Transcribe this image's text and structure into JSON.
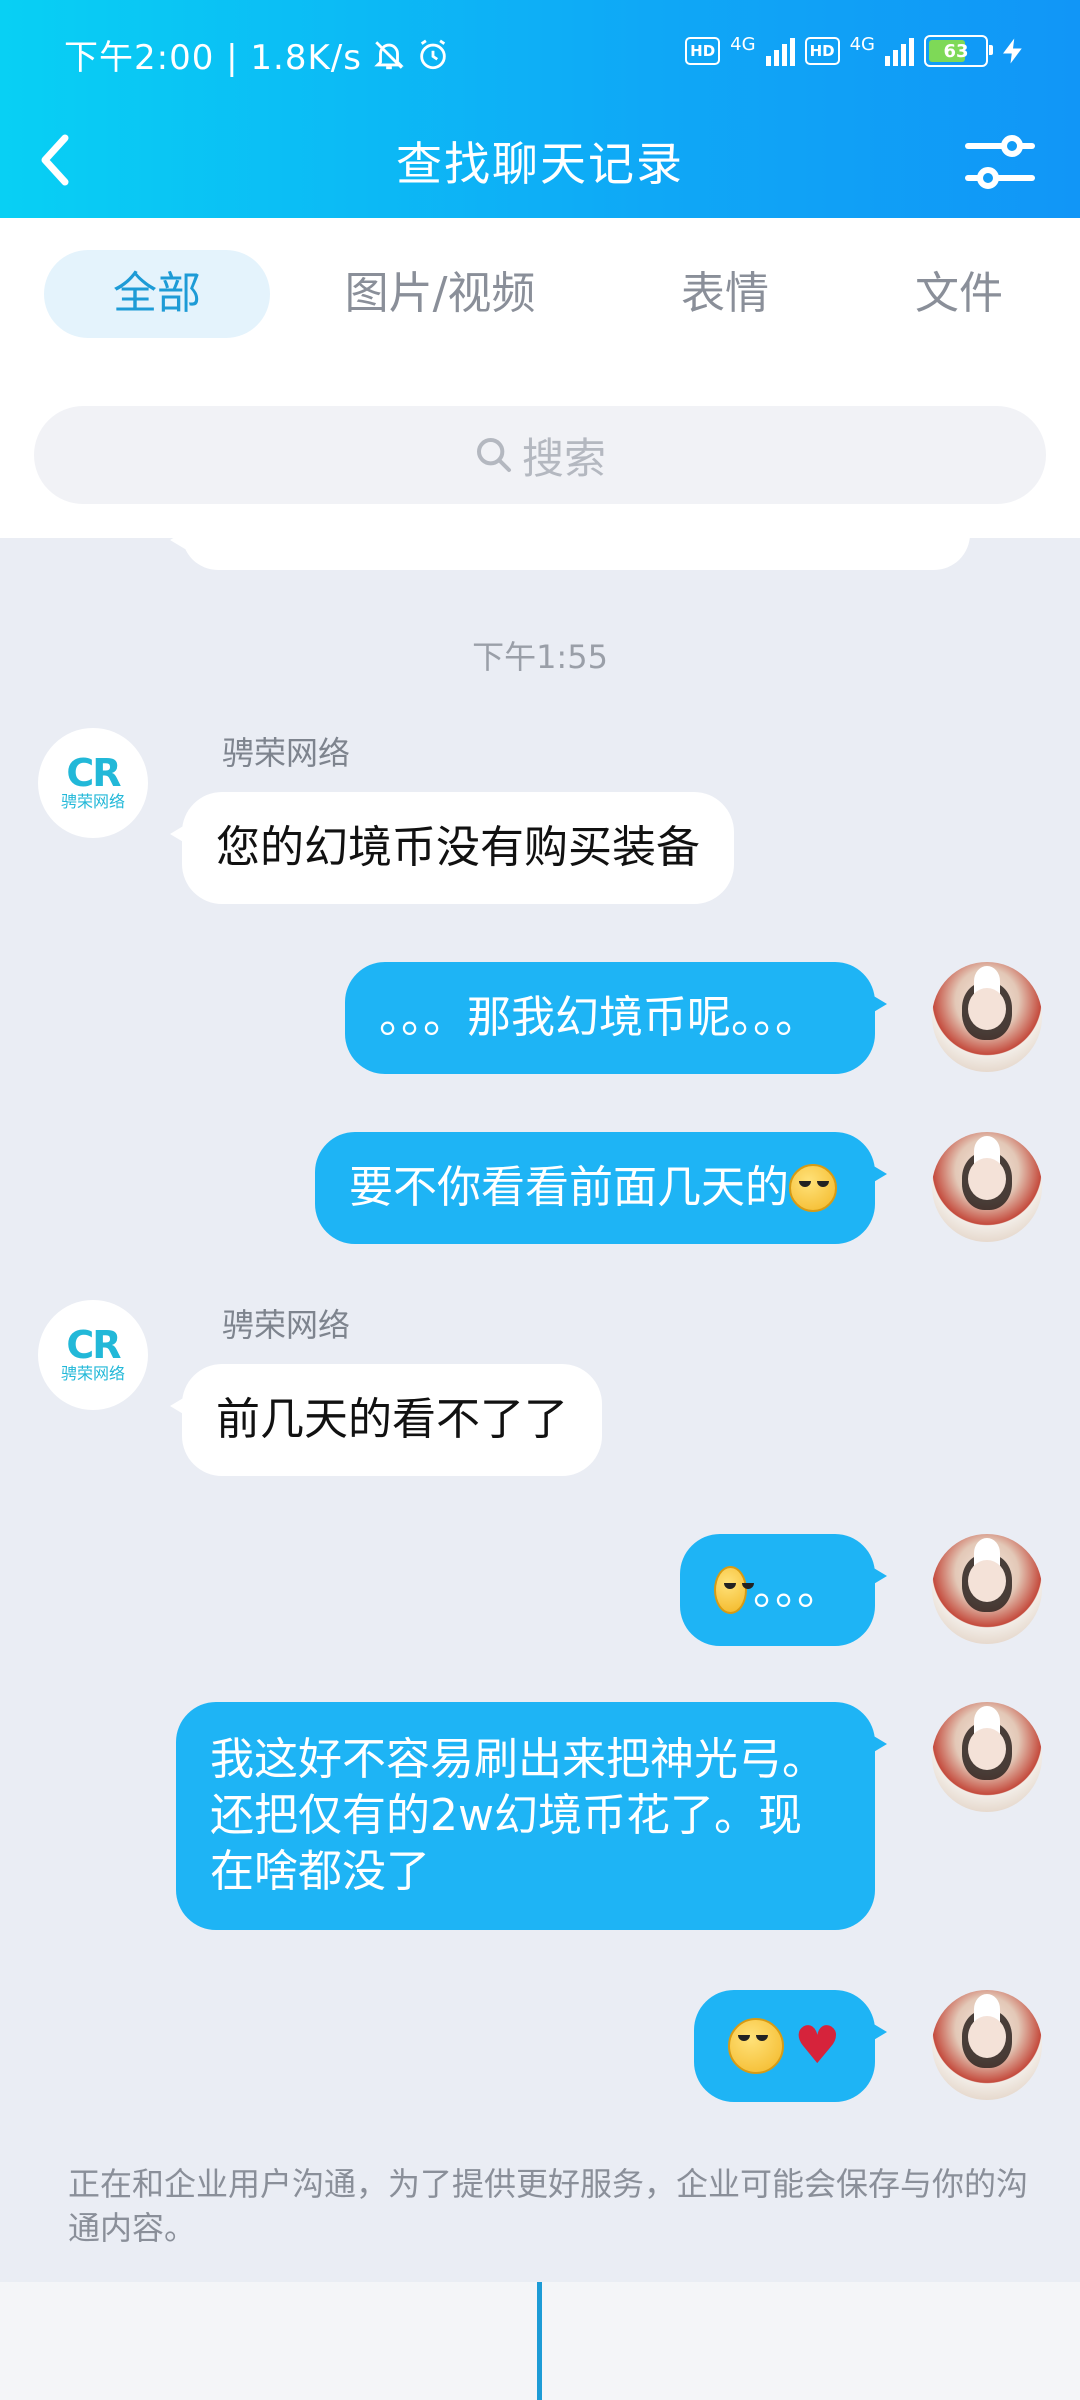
{
  "status_bar": {
    "time_speed": "下午2:00 | 1.8K/s",
    "hd1": "HD",
    "net1": "4G",
    "hd2": "HD",
    "net2": "4G",
    "battery": "63"
  },
  "header": {
    "title": "查找聊天记录"
  },
  "tabs": [
    {
      "label": "全部",
      "active": true
    },
    {
      "label": "图片/视频",
      "active": false
    },
    {
      "label": "表情",
      "active": false
    },
    {
      "label": "文件",
      "active": false
    }
  ],
  "search": {
    "placeholder": "搜索"
  },
  "messages": {
    "timestamp": "下午1:55",
    "m1": {
      "sender": "骋荣网络",
      "text": "您的幻境币没有购买装备"
    },
    "m2": {
      "text": "。。。那我幻境币呢。。。"
    },
    "m3": {
      "text": "要不你看看前面几天的"
    },
    "m4": {
      "sender": "骋荣网络",
      "text": "前几天的看不了了"
    },
    "m5": {
      "text": "。。。"
    },
    "m6": {
      "line1": "我这好不容易刷出来把神光弓。",
      "line2": "还把仅有的2w幻境币花了。现",
      "line3": "在啥都没了"
    },
    "m7": {
      "text": ""
    }
  },
  "sender_logo": {
    "mark": "CR",
    "sub": "骋荣网络"
  },
  "notice": "正在和企业用户沟通，为了提供更好服务，企业可能会保存与你的沟通内容。",
  "colors": {
    "header_start": "#08d0f4",
    "header_end": "#1196f7",
    "outgoing_bubble": "#1eb4f5",
    "active_tab": "#1d9bd6"
  }
}
